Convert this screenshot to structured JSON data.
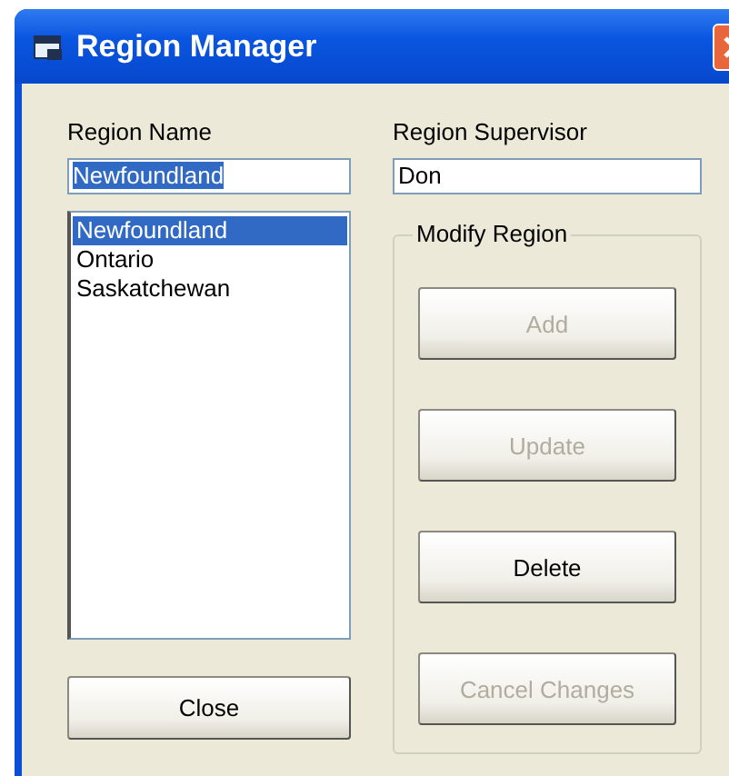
{
  "window": {
    "title": "Region Manager"
  },
  "region_name": {
    "label": "Region Name",
    "value": "Newfoundland",
    "text_selected": true
  },
  "regions": [
    {
      "label": "Newfoundland",
      "selected": true
    },
    {
      "label": "Ontario",
      "selected": false
    },
    {
      "label": "Saskatchewan",
      "selected": false
    }
  ],
  "close_button": {
    "label": "Close",
    "disabled": false
  },
  "region_supervisor": {
    "label": "Region Supervisor",
    "value": "Don"
  },
  "modify_region": {
    "title": "Modify Region",
    "buttons": [
      {
        "label": "Add",
        "disabled": true
      },
      {
        "label": "Update",
        "disabled": true
      },
      {
        "label": "Delete",
        "disabled": false
      },
      {
        "label": "Cancel Changes",
        "disabled": true
      }
    ]
  }
}
